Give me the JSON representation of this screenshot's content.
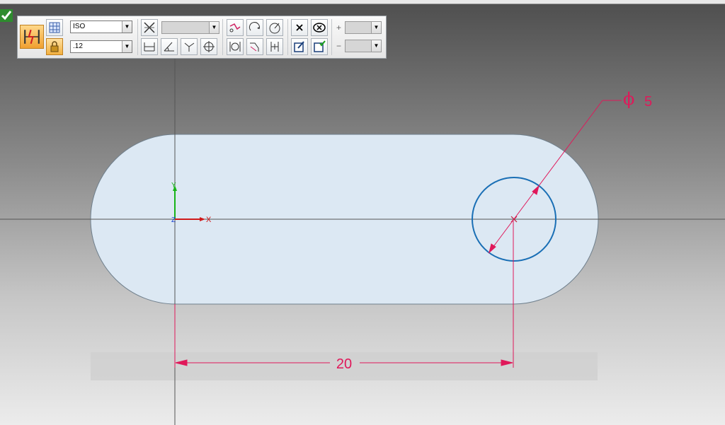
{
  "toolbar": {
    "standard_value": "ISO",
    "precision_value": ".12",
    "tolerance_plus_symbol": "+",
    "tolerance_minus_symbol": "−"
  },
  "drawing": {
    "diameter_symbol": "ϕ",
    "diameter_value": "5",
    "linear_dimension": "20",
    "axis_x": "X",
    "axis_y": "Y",
    "axis_z": "Z"
  },
  "colors": {
    "dimension": "#e0185a",
    "circle": "#1a6fb5",
    "part_fill": "#dce8f3",
    "axis_x": "#d01a1a",
    "axis_y": "#18b418"
  }
}
